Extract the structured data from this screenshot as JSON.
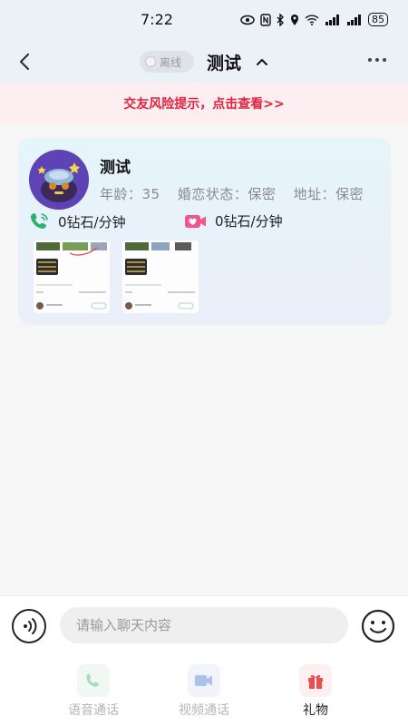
{
  "status_bar": {
    "time": "7:22",
    "battery": "85"
  },
  "header": {
    "online_status": "离线",
    "title": "测试"
  },
  "risk_banner": {
    "text": "交友风险提示，点击查看>>"
  },
  "profile": {
    "name": "测试",
    "age": "年龄：35",
    "marital": "婚恋状态：保密",
    "address": "地址：保密",
    "voice_rate": "0钻石/分钟",
    "video_rate": "0钻石/分钟"
  },
  "input_bar": {
    "placeholder": "请输入聊天内容"
  },
  "actions": {
    "voice_call": "语音通话",
    "video_call": "视频通话",
    "gift": "礼物"
  },
  "colors": {
    "risk_text": "#e0233d",
    "risk_bg": "#fdeff1",
    "voice_green": "#2bb36b",
    "video_pink": "#f2558a",
    "gift_red": "#f04a4a"
  }
}
